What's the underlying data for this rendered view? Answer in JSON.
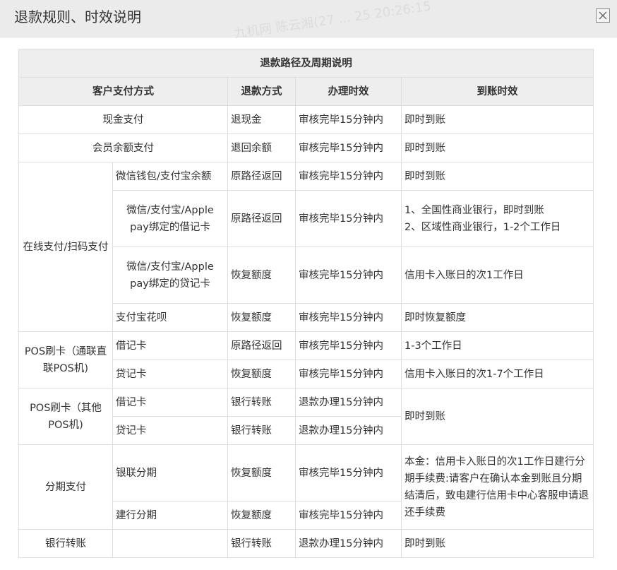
{
  "dialog": {
    "title": "退款规则、时效说明",
    "watermark": "九机网 陈云湘(27 ... 25 20:26:15"
  },
  "table": {
    "caption": "退款路径及周期说明",
    "headers": {
      "payment_method": "客户支付方式",
      "refund_method": "退款方式",
      "processing_time": "办理时效",
      "arrival_time": "到账时效"
    },
    "cash": {
      "method": "现金支付",
      "refund": "退现金",
      "process": "审核完毕15分钟内",
      "arrival": "即时到账"
    },
    "member": {
      "method": "会员余额支付",
      "refund": "退回余额",
      "process": "审核完毕15分钟内",
      "arrival": "即时到账"
    },
    "online": {
      "group": "在线支付/扫码支付",
      "rows": [
        {
          "sub": "微信钱包/支付宝余额",
          "refund": "原路径返回",
          "process": "审核完毕15分钟内",
          "arrival": "即时到账"
        },
        {
          "sub": "微信/支付宝/Apple pay绑定的借记卡",
          "refund": "原路径返回",
          "process": "审核完毕15分钟内",
          "arrival1": "1、全国性商业银行，即时到账",
          "arrival2": "2、区域性商业银行，1-2个工作日"
        },
        {
          "sub": "微信/支付宝/Apple pay绑定的贷记卡",
          "refund": "恢复额度",
          "process": "审核完毕15分钟内",
          "arrival": "信用卡入账日的次1工作日"
        },
        {
          "sub": "支付宝花呗",
          "refund": "恢复额度",
          "process": "审核完毕15分钟内",
          "arrival": "即时恢复额度"
        }
      ]
    },
    "pos_direct": {
      "group": "POS刷卡（通联直联POS机)",
      "rows": [
        {
          "sub": "借记卡",
          "refund": "原路径返回",
          "process": "审核完毕15分钟内",
          "arrival": "1-3个工作日"
        },
        {
          "sub": "贷记卡",
          "refund": "恢复额度",
          "process": "审核完毕15分钟内",
          "arrival": "信用卡入账日的次1-7个工作日"
        }
      ]
    },
    "pos_other": {
      "group": "POS刷卡（其他POS机)",
      "arrival": "即时到账",
      "rows": [
        {
          "sub": "借记卡",
          "refund": "银行转账",
          "process": "退款办理15分钟内"
        },
        {
          "sub": "贷记卡",
          "refund": "银行转账",
          "process": "退款办理15分钟内"
        }
      ]
    },
    "installment": {
      "group": "分期支付",
      "arrival": "本金：信用卡入账日的次1工作日建行分期手续费:请客户在确认本金到账且分期结清后，致电建行信用卡中心客服申请退还手续费",
      "rows": [
        {
          "sub": "银联分期",
          "refund": "恢复额度",
          "process": "审核完毕15分钟内"
        },
        {
          "sub": "建行分期",
          "refund": "恢复额度",
          "process": "审核完毕15分钟内"
        }
      ]
    },
    "transfer": {
      "method": "银行转账",
      "sub": "",
      "refund": "银行转账",
      "process": "退款办理15分钟内",
      "arrival": "即时到账"
    }
  }
}
